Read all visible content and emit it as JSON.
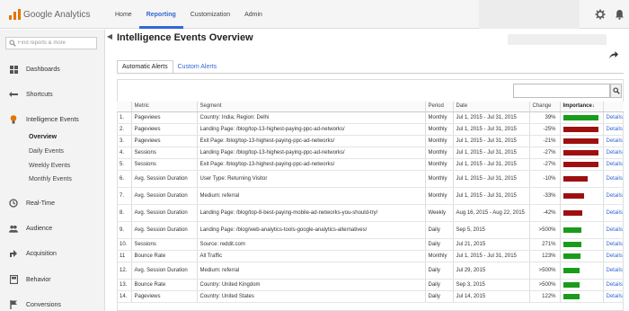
{
  "header": {
    "logo_text": "Google Analytics",
    "nav": [
      "Home",
      "Reporting",
      "Customization",
      "Admin"
    ],
    "active_nav": "Reporting"
  },
  "sidebar": {
    "search_placeholder": "Find reports & more",
    "items": [
      {
        "label": "Dashboards",
        "icon": "dashboards-icon"
      },
      {
        "label": "Shortcuts",
        "icon": "shortcuts-icon"
      },
      {
        "label": "Intelligence Events",
        "icon": "intelligence-events-icon"
      },
      {
        "label": "Real-Time",
        "icon": "real-time-icon"
      },
      {
        "label": "Audience",
        "icon": "audience-icon"
      },
      {
        "label": "Acquisition",
        "icon": "acquisition-icon"
      },
      {
        "label": "Behavior",
        "icon": "behavior-icon"
      },
      {
        "label": "Conversions",
        "icon": "conversions-icon"
      }
    ],
    "subitems": [
      "Overview",
      "Daily Events",
      "Weekly Events",
      "Monthly Events"
    ],
    "active_subitem": "Overview"
  },
  "page": {
    "title": "Intelligence Events Overview",
    "tabs": [
      "Automatic Alerts",
      "Custom Alerts"
    ],
    "active_tab": "Automatic Alerts"
  },
  "table": {
    "columns": [
      "",
      "Metric",
      "Segment",
      "Period",
      "Date",
      "Change",
      "Importance",
      ""
    ],
    "rows": [
      {
        "n": "1.",
        "metric": "Pageviews",
        "segment": "Country: India; Region: Delhi",
        "period": "Monthly",
        "date": "Jul 1, 2015 - Jul 31, 2015",
        "change": "39%",
        "importance": 1.0,
        "color": "#1a9c1a",
        "details": "Details"
      },
      {
        "n": "2.",
        "metric": "Pageviews",
        "segment": "Landing Page: /blog/top-13-highest-paying-ppc-ad-networks/",
        "period": "Monthly",
        "date": "Jul 1, 2015 - Jul 31, 2015",
        "change": "-25%",
        "importance": 1.0,
        "color": "#9e1010",
        "details": "Details"
      },
      {
        "n": "3.",
        "metric": "Pageviews",
        "segment": "Exit Page: /blog/top-13-highest-paying-ppc-ad-networks/",
        "period": "Monthly",
        "date": "Jul 1, 2015 - Jul 31, 2015",
        "change": "-21%",
        "importance": 1.0,
        "color": "#9e1010",
        "details": "Details"
      },
      {
        "n": "4.",
        "metric": "Sessions",
        "segment": "Landing Page: /blog/top-13-highest-paying-ppc-ad-networks/",
        "period": "Monthly",
        "date": "Jul 1, 2015 - Jul 31, 2015",
        "change": "-27%",
        "importance": 1.0,
        "color": "#9e1010",
        "details": "Details"
      },
      {
        "n": "5.",
        "metric": "Sessions",
        "segment": "Exit Page: /blog/top-13-highest-paying-ppc-ad-networks/",
        "period": "Monthly",
        "date": "Jul 1, 2015 - Jul 31, 2015",
        "change": "-27%",
        "importance": 1.0,
        "color": "#9e1010",
        "details": "Details"
      },
      {
        "n": "6.",
        "metric": "Avg. Session Duration",
        "segment": "User Type: Returning Visitor",
        "period": "Monthly",
        "date": "Jul 1, 2015 - Jul 31, 2015",
        "change": "-10%",
        "importance": 0.68,
        "color": "#9e1010",
        "details": "Details"
      },
      {
        "n": "7.",
        "metric": "Avg. Session Duration",
        "segment": "Medium: referral",
        "period": "Monthly",
        "date": "Jul 1, 2015 - Jul 31, 2015",
        "change": "-33%",
        "importance": 0.58,
        "color": "#9e1010",
        "details": "Details"
      },
      {
        "n": "8.",
        "metric": "Avg. Session Duration",
        "segment": "Landing Page: /blog/top-8-best-paying-mobile-ad-networks-you-should-try/",
        "period": "Weekly",
        "date": "Aug 16, 2015 - Aug 22, 2015",
        "change": "-42%",
        "importance": 0.53,
        "color": "#9e1010",
        "details": "Details"
      },
      {
        "n": "9.",
        "metric": "Avg. Session Duration",
        "segment": "Landing Page: /blog/web-analytics-tools-google-analytics-alternatives/",
        "period": "Daily",
        "date": "Sep 5, 2015",
        "change": ">500%",
        "importance": 0.5,
        "color": "#1a9c1a",
        "details": "Details"
      },
      {
        "n": "10.",
        "metric": "Sessions",
        "segment": "Source: reddit.com",
        "period": "Daily",
        "date": "Jul 21, 2015",
        "change": "271%",
        "importance": 0.5,
        "color": "#1a9c1a",
        "details": "Details"
      },
      {
        "n": "11",
        "metric": "Bounce Rate",
        "segment": "All Traffic",
        "period": "Monthly",
        "date": "Jul 1, 2015 - Jul 31, 2015",
        "change": "123%",
        "importance": 0.48,
        "color": "#1a9c1a",
        "details": "Details"
      },
      {
        "n": "12.",
        "metric": "Avg. Session Duration",
        "segment": "Medium: referral",
        "period": "Daily",
        "date": "Jul 29, 2015",
        "change": ">500%",
        "importance": 0.45,
        "color": "#1a9c1a",
        "details": "Details"
      },
      {
        "n": "13.",
        "metric": "Bounce Rate",
        "segment": "Country: United Kingdom",
        "period": "Daily",
        "date": "Sep 3, 2015",
        "change": ">500%",
        "importance": 0.45,
        "color": "#1a9c1a",
        "details": "Details"
      },
      {
        "n": "14.",
        "metric": "Pageviews",
        "segment": "Country: United States",
        "period": "Daily",
        "date": "Jul 14, 2015",
        "change": "122%",
        "importance": 0.45,
        "color": "#1a9c1a",
        "details": "Details"
      }
    ]
  }
}
